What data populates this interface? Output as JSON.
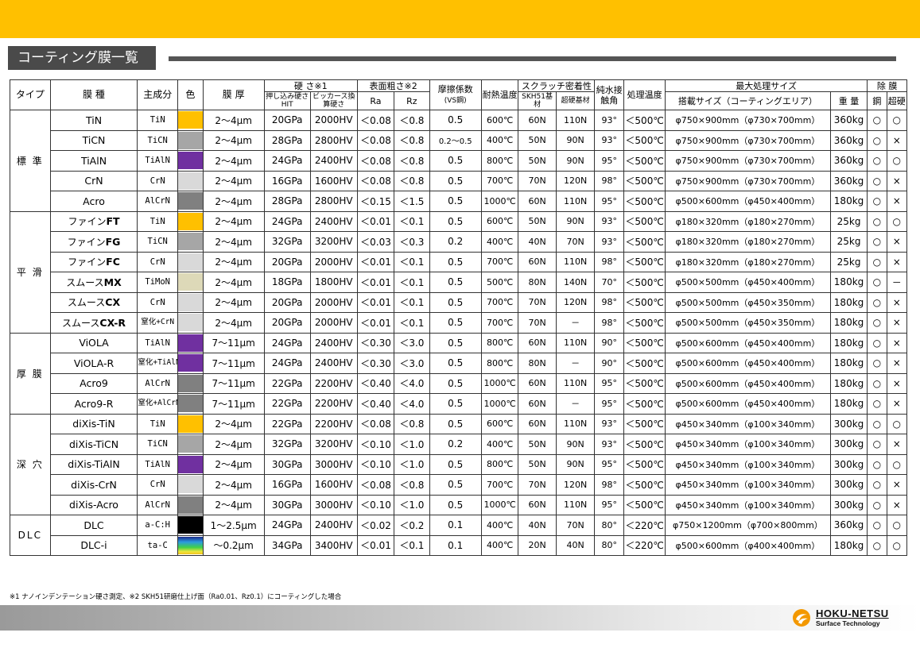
{
  "slide_title": "コーティング膜一覧",
  "header": {
    "type": "タイプ",
    "film_type": "膜 種",
    "main_component": "主成分",
    "color": "色",
    "thickness": "膜 厚",
    "hardness": "硬 さ※1",
    "hardness_hit": "押し込み硬さHIT",
    "hardness_hv": "ビッカース換算硬さ",
    "roughness": "表面粗さ※2",
    "ra": "Ra",
    "rz": "Rz",
    "friction": "摩擦係数",
    "friction_sub": "(VS鋼)",
    "heat": "耐熱温度",
    "scratch": "スクラッチ密着性",
    "scratch_skh": "SKH51基材",
    "scratch_carbide": "超硬基材",
    "contact": "純水接触角",
    "process_temp": "処理温度",
    "max_size": "最大処理サイズ",
    "size_area": "搭載サイズ（コーティングエリア）",
    "weight": "重 量",
    "removal": "除 膜",
    "steel": "鋼",
    "carbide": "超硬"
  },
  "groups": [
    {
      "category": "標 準",
      "rows": [
        {
          "name": "TiN",
          "comp": "TiN",
          "color": "#FFC000",
          "thick": "2～4μm",
          "hit": "20GPa",
          "hv": "2000HV",
          "ra": "＜0.08",
          "rz": "＜0.8",
          "fric": "0.5",
          "heat": "600℃",
          "skh": "60N",
          "carb": "110N",
          "angle": "93°",
          "ptemp": "＜500℃",
          "size": "φ750×900mm（φ730×700mm）",
          "weight": "360kg",
          "steel": "○",
          "carbide": "○"
        },
        {
          "name": "TiCN",
          "comp": "TiCN",
          "color": "#A6A6A6",
          "thick": "2～4μm",
          "hit": "28GPa",
          "hv": "2800HV",
          "ra": "＜0.08",
          "rz": "＜0.8",
          "fric": "0.2～0.5",
          "heat": "400℃",
          "skh": "50N",
          "carb": "90N",
          "angle": "93°",
          "ptemp": "＜500℃",
          "size": "φ750×900mm（φ730×700mm）",
          "weight": "360kg",
          "steel": "○",
          "carbide": "×"
        },
        {
          "name": "TiAlN",
          "comp": "TiAlN",
          "color": "#7030A0",
          "thick": "2～4μm",
          "hit": "24GPa",
          "hv": "2400HV",
          "ra": "＜0.08",
          "rz": "＜0.8",
          "fric": "0.5",
          "heat": "800℃",
          "skh": "50N",
          "carb": "90N",
          "angle": "95°",
          "ptemp": "＜500℃",
          "size": "φ750×900mm（φ730×700mm）",
          "weight": "360kg",
          "steel": "○",
          "carbide": "○"
        },
        {
          "name": "CrN",
          "comp": "CrN",
          "color": "#D9D9D9",
          "thick": "2～4μm",
          "hit": "16GPa",
          "hv": "1600HV",
          "ra": "＜0.08",
          "rz": "＜0.8",
          "fric": "0.5",
          "heat": "700℃",
          "skh": "70N",
          "carb": "120N",
          "angle": "98°",
          "ptemp": "＜500℃",
          "size": "φ750×900mm（φ730×700mm）",
          "weight": "360kg",
          "steel": "○",
          "carbide": "×"
        },
        {
          "name": "Acro",
          "comp": "AlCrN",
          "color": "#808080",
          "thick": "2～4μm",
          "hit": "28GPa",
          "hv": "2800HV",
          "ra": "＜0.15",
          "rz": "＜1.5",
          "fric": "0.5",
          "heat": "1000℃",
          "skh": "60N",
          "carb": "110N",
          "angle": "95°",
          "ptemp": "＜500℃",
          "size": "φ500×600mm（φ450×400mm）",
          "weight": "180kg",
          "steel": "○",
          "carbide": "×"
        }
      ]
    },
    {
      "category": "平 滑",
      "rows": [
        {
          "prefix": "ファイン",
          "name": "FT",
          "comp": "TiN",
          "color": "#FFC000",
          "thick": "2～4μm",
          "hit": "24GPa",
          "hv": "2400HV",
          "ra": "＜0.01",
          "rz": "＜0.1",
          "fric": "0.5",
          "heat": "600℃",
          "skh": "50N",
          "carb": "90N",
          "angle": "93°",
          "ptemp": "＜500℃",
          "size": "φ180×320mm（φ180×270mm）",
          "weight": "25kg",
          "steel": "○",
          "carbide": "○"
        },
        {
          "prefix": "ファイン",
          "name": "FG",
          "comp": "TiCN",
          "color": "#A6A6A6",
          "thick": "2～4μm",
          "hit": "32GPa",
          "hv": "3200HV",
          "ra": "＜0.03",
          "rz": "＜0.3",
          "fric": "0.2",
          "heat": "400℃",
          "skh": "40N",
          "carb": "70N",
          "angle": "93°",
          "ptemp": "＜500℃",
          "size": "φ180×320mm（φ180×270mm）",
          "weight": "25kg",
          "steel": "○",
          "carbide": "×"
        },
        {
          "prefix": "ファイン",
          "name": "FC",
          "comp": "CrN",
          "color": "#D9D9D9",
          "thick": "2～4μm",
          "hit": "20GPa",
          "hv": "2000HV",
          "ra": "＜0.01",
          "rz": "＜0.1",
          "fric": "0.5",
          "heat": "700℃",
          "skh": "60N",
          "carb": "110N",
          "angle": "98°",
          "ptemp": "＜500℃",
          "size": "φ180×320mm（φ180×270mm）",
          "weight": "25kg",
          "steel": "○",
          "carbide": "×"
        },
        {
          "prefix": "スムース",
          "name": "MX",
          "comp": "TiMoN",
          "color": "#DDD9B8",
          "thick": "2～4μm",
          "hit": "18GPa",
          "hv": "1800HV",
          "ra": "＜0.01",
          "rz": "＜0.1",
          "fric": "0.5",
          "heat": "500℃",
          "skh": "80N",
          "carb": "140N",
          "angle": "70°",
          "ptemp": "＜500℃",
          "size": "φ500×500mm（φ450×400mm）",
          "weight": "180kg",
          "steel": "○",
          "carbide": "－"
        },
        {
          "prefix": "スムース",
          "name": "CX",
          "comp": "CrN",
          "color": "#D9D9D9",
          "thick": "2～4μm",
          "hit": "20GPa",
          "hv": "2000HV",
          "ra": "＜0.01",
          "rz": "＜0.1",
          "fric": "0.5",
          "heat": "700℃",
          "skh": "70N",
          "carb": "120N",
          "angle": "98°",
          "ptemp": "＜500℃",
          "size": "φ500×500mm（φ450×350mm）",
          "weight": "180kg",
          "steel": "○",
          "carbide": "×"
        },
        {
          "prefix": "スムース",
          "name": "CX-R",
          "comp": "窒化+CrN",
          "color": "#D9D9D9",
          "thick": "2～4μm",
          "hit": "20GPa",
          "hv": "2000HV",
          "ra": "＜0.01",
          "rz": "＜0.1",
          "fric": "0.5",
          "heat": "700℃",
          "skh": "70N",
          "carb": "－",
          "angle": "98°",
          "ptemp": "＜500℃",
          "size": "φ500×500mm（φ450×350mm）",
          "weight": "180kg",
          "steel": "○",
          "carbide": "×"
        }
      ]
    },
    {
      "category": "厚 膜",
      "rows": [
        {
          "name": "ViOLA",
          "comp": "TiAlN",
          "color": "#7030A0",
          "thick": "7～11μm",
          "hit": "24GPa",
          "hv": "2400HV",
          "ra": "＜0.30",
          "rz": "＜3.0",
          "fric": "0.5",
          "heat": "800℃",
          "skh": "60N",
          "carb": "110N",
          "angle": "90°",
          "ptemp": "＜500℃",
          "size": "φ500×600mm（φ450×400mm）",
          "weight": "180kg",
          "steel": "○",
          "carbide": "×"
        },
        {
          "name": "ViOLA-R",
          "comp": "窒化+TiAlN",
          "color": "#7030A0",
          "thick": "7～11μm",
          "hit": "24GPa",
          "hv": "2400HV",
          "ra": "＜0.30",
          "rz": "＜3.0",
          "fric": "0.5",
          "heat": "800℃",
          "skh": "80N",
          "carb": "－",
          "angle": "90°",
          "ptemp": "＜500℃",
          "size": "φ500×600mm（φ450×400mm）",
          "weight": "180kg",
          "steel": "○",
          "carbide": "×"
        },
        {
          "name": "Acro9",
          "comp": "AlCrN",
          "color": "#808080",
          "thick": "7～11μm",
          "hit": "22GPa",
          "hv": "2200HV",
          "ra": "＜0.40",
          "rz": "＜4.0",
          "fric": "0.5",
          "heat": "1000℃",
          "skh": "60N",
          "carb": "110N",
          "angle": "95°",
          "ptemp": "＜500℃",
          "size": "φ500×600mm（φ450×400mm）",
          "weight": "180kg",
          "steel": "○",
          "carbide": "×"
        },
        {
          "name": "Acro9-R",
          "comp": "窒化+AlCrN",
          "color": "#808080",
          "thick": "7～11μm",
          "hit": "22GPa",
          "hv": "2200HV",
          "ra": "＜0.40",
          "rz": "＜4.0",
          "fric": "0.5",
          "heat": "1000℃",
          "skh": "60N",
          "carb": "－",
          "angle": "95°",
          "ptemp": "＜500℃",
          "size": "φ500×600mm（φ450×400mm）",
          "weight": "180kg",
          "steel": "○",
          "carbide": "×"
        }
      ]
    },
    {
      "category": "深 穴",
      "rows": [
        {
          "name": "diXis-TiN",
          "comp": "TiN",
          "color": "#FFC000",
          "thick": "2～4μm",
          "hit": "22GPa",
          "hv": "2200HV",
          "ra": "＜0.08",
          "rz": "＜0.8",
          "fric": "0.5",
          "heat": "600℃",
          "skh": "60N",
          "carb": "110N",
          "angle": "93°",
          "ptemp": "＜500℃",
          "size": "φ450×340mm（φ100×340mm）",
          "weight": "300kg",
          "steel": "○",
          "carbide": "○"
        },
        {
          "name": "diXis-TiCN",
          "comp": "TiCN",
          "color": "#A6A6A6",
          "thick": "2～4μm",
          "hit": "32GPa",
          "hv": "3200HV",
          "ra": "＜0.10",
          "rz": "＜1.0",
          "fric": "0.2",
          "heat": "400℃",
          "skh": "50N",
          "carb": "90N",
          "angle": "93°",
          "ptemp": "＜500℃",
          "size": "φ450×340mm（φ100×340mm）",
          "weight": "300kg",
          "steel": "○",
          "carbide": "×"
        },
        {
          "name": "diXis-TiAlN",
          "comp": "TiAlN",
          "color": "#7030A0",
          "thick": "2～4μm",
          "hit": "30GPa",
          "hv": "3000HV",
          "ra": "＜0.10",
          "rz": "＜1.0",
          "fric": "0.5",
          "heat": "800℃",
          "skh": "50N",
          "carb": "90N",
          "angle": "95°",
          "ptemp": "＜500℃",
          "size": "φ450×340mm（φ100×340mm）",
          "weight": "300kg",
          "steel": "○",
          "carbide": "○"
        },
        {
          "name": "diXis-CrN",
          "comp": "CrN",
          "color": "#D9D9D9",
          "thick": "2～4μm",
          "hit": "16GPa",
          "hv": "1600HV",
          "ra": "＜0.08",
          "rz": "＜0.8",
          "fric": "0.5",
          "heat": "700℃",
          "skh": "70N",
          "carb": "120N",
          "angle": "98°",
          "ptemp": "＜500℃",
          "size": "φ450×340mm（φ100×340mm）",
          "weight": "300kg",
          "steel": "○",
          "carbide": "×"
        },
        {
          "name": "diXis-Acro",
          "comp": "AlCrN",
          "color": "#808080",
          "thick": "2～4μm",
          "hit": "30GPa",
          "hv": "3000HV",
          "ra": "＜0.10",
          "rz": "＜1.0",
          "fric": "0.5",
          "heat": "1000℃",
          "skh": "60N",
          "carb": "110N",
          "angle": "95°",
          "ptemp": "＜500℃",
          "size": "φ450×340mm（φ100×340mm）",
          "weight": "300kg",
          "steel": "○",
          "carbide": "×"
        }
      ]
    },
    {
      "category": "DLC",
      "rows": [
        {
          "name": "DLC",
          "comp": "a-C:H",
          "color": "#000000",
          "thick": "1～2.5μm",
          "hit": "24GPa",
          "hv": "2400HV",
          "ra": "＜0.02",
          "rz": "＜0.2",
          "fric": "0.1",
          "heat": "400℃",
          "skh": "40N",
          "carb": "70N",
          "angle": "80°",
          "ptemp": "＜220℃",
          "size": "φ750×1200mm（φ700×800mm）",
          "weight": "360kg",
          "steel": "○",
          "carbide": "○"
        },
        {
          "name": "DLC-i",
          "comp": "ta-C",
          "color": "rainbow",
          "thick": "～0.2μm",
          "hit": "34GPa",
          "hv": "3400HV",
          "ra": "＜0.01",
          "rz": "＜0.1",
          "fric": "0.1",
          "heat": "400℃",
          "skh": "20N",
          "carb": "40N",
          "angle": "80°",
          "ptemp": "＜220℃",
          "size": "φ500×600mm（φ400×400mm）",
          "weight": "180kg",
          "steel": "○",
          "carbide": "○"
        }
      ]
    }
  ],
  "footnote": "※1 ナノインデンテーション硬さ測定、※2 SKH51研磨仕上げ面（Ra0.01、Rz0.1）にコーティングした場合",
  "logo": {
    "name": "HOKU-NETSU",
    "sub": "Surface Technology"
  },
  "colors": {
    "accent": "#FFC000",
    "title_bg": "#4a4a4a"
  }
}
